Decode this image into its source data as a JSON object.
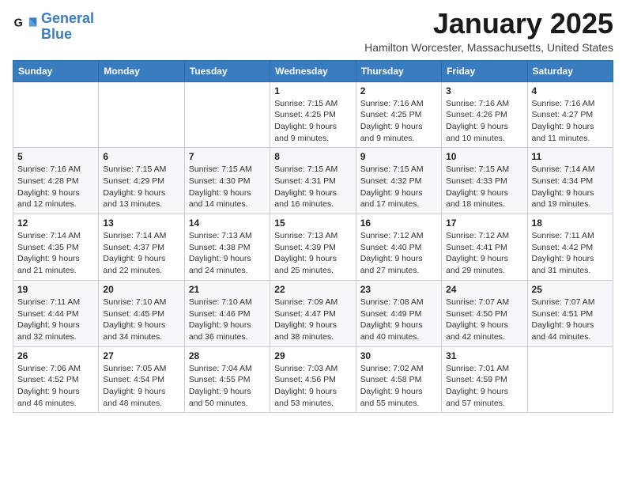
{
  "logo": {
    "line1": "General",
    "line2": "Blue"
  },
  "title": "January 2025",
  "location": "Hamilton Worcester, Massachusetts, United States",
  "weekdays": [
    "Sunday",
    "Monday",
    "Tuesday",
    "Wednesday",
    "Thursday",
    "Friday",
    "Saturday"
  ],
  "weeks": [
    [
      {
        "day": "",
        "info": ""
      },
      {
        "day": "",
        "info": ""
      },
      {
        "day": "",
        "info": ""
      },
      {
        "day": "1",
        "info": "Sunrise: 7:15 AM\nSunset: 4:25 PM\nDaylight: 9 hours\nand 9 minutes."
      },
      {
        "day": "2",
        "info": "Sunrise: 7:16 AM\nSunset: 4:25 PM\nDaylight: 9 hours\nand 9 minutes."
      },
      {
        "day": "3",
        "info": "Sunrise: 7:16 AM\nSunset: 4:26 PM\nDaylight: 9 hours\nand 10 minutes."
      },
      {
        "day": "4",
        "info": "Sunrise: 7:16 AM\nSunset: 4:27 PM\nDaylight: 9 hours\nand 11 minutes."
      }
    ],
    [
      {
        "day": "5",
        "info": "Sunrise: 7:16 AM\nSunset: 4:28 PM\nDaylight: 9 hours\nand 12 minutes."
      },
      {
        "day": "6",
        "info": "Sunrise: 7:15 AM\nSunset: 4:29 PM\nDaylight: 9 hours\nand 13 minutes."
      },
      {
        "day": "7",
        "info": "Sunrise: 7:15 AM\nSunset: 4:30 PM\nDaylight: 9 hours\nand 14 minutes."
      },
      {
        "day": "8",
        "info": "Sunrise: 7:15 AM\nSunset: 4:31 PM\nDaylight: 9 hours\nand 16 minutes."
      },
      {
        "day": "9",
        "info": "Sunrise: 7:15 AM\nSunset: 4:32 PM\nDaylight: 9 hours\nand 17 minutes."
      },
      {
        "day": "10",
        "info": "Sunrise: 7:15 AM\nSunset: 4:33 PM\nDaylight: 9 hours\nand 18 minutes."
      },
      {
        "day": "11",
        "info": "Sunrise: 7:14 AM\nSunset: 4:34 PM\nDaylight: 9 hours\nand 19 minutes."
      }
    ],
    [
      {
        "day": "12",
        "info": "Sunrise: 7:14 AM\nSunset: 4:35 PM\nDaylight: 9 hours\nand 21 minutes."
      },
      {
        "day": "13",
        "info": "Sunrise: 7:14 AM\nSunset: 4:37 PM\nDaylight: 9 hours\nand 22 minutes."
      },
      {
        "day": "14",
        "info": "Sunrise: 7:13 AM\nSunset: 4:38 PM\nDaylight: 9 hours\nand 24 minutes."
      },
      {
        "day": "15",
        "info": "Sunrise: 7:13 AM\nSunset: 4:39 PM\nDaylight: 9 hours\nand 25 minutes."
      },
      {
        "day": "16",
        "info": "Sunrise: 7:12 AM\nSunset: 4:40 PM\nDaylight: 9 hours\nand 27 minutes."
      },
      {
        "day": "17",
        "info": "Sunrise: 7:12 AM\nSunset: 4:41 PM\nDaylight: 9 hours\nand 29 minutes."
      },
      {
        "day": "18",
        "info": "Sunrise: 7:11 AM\nSunset: 4:42 PM\nDaylight: 9 hours\nand 31 minutes."
      }
    ],
    [
      {
        "day": "19",
        "info": "Sunrise: 7:11 AM\nSunset: 4:44 PM\nDaylight: 9 hours\nand 32 minutes."
      },
      {
        "day": "20",
        "info": "Sunrise: 7:10 AM\nSunset: 4:45 PM\nDaylight: 9 hours\nand 34 minutes."
      },
      {
        "day": "21",
        "info": "Sunrise: 7:10 AM\nSunset: 4:46 PM\nDaylight: 9 hours\nand 36 minutes."
      },
      {
        "day": "22",
        "info": "Sunrise: 7:09 AM\nSunset: 4:47 PM\nDaylight: 9 hours\nand 38 minutes."
      },
      {
        "day": "23",
        "info": "Sunrise: 7:08 AM\nSunset: 4:49 PM\nDaylight: 9 hours\nand 40 minutes."
      },
      {
        "day": "24",
        "info": "Sunrise: 7:07 AM\nSunset: 4:50 PM\nDaylight: 9 hours\nand 42 minutes."
      },
      {
        "day": "25",
        "info": "Sunrise: 7:07 AM\nSunset: 4:51 PM\nDaylight: 9 hours\nand 44 minutes."
      }
    ],
    [
      {
        "day": "26",
        "info": "Sunrise: 7:06 AM\nSunset: 4:52 PM\nDaylight: 9 hours\nand 46 minutes."
      },
      {
        "day": "27",
        "info": "Sunrise: 7:05 AM\nSunset: 4:54 PM\nDaylight: 9 hours\nand 48 minutes."
      },
      {
        "day": "28",
        "info": "Sunrise: 7:04 AM\nSunset: 4:55 PM\nDaylight: 9 hours\nand 50 minutes."
      },
      {
        "day": "29",
        "info": "Sunrise: 7:03 AM\nSunset: 4:56 PM\nDaylight: 9 hours\nand 53 minutes."
      },
      {
        "day": "30",
        "info": "Sunrise: 7:02 AM\nSunset: 4:58 PM\nDaylight: 9 hours\nand 55 minutes."
      },
      {
        "day": "31",
        "info": "Sunrise: 7:01 AM\nSunset: 4:59 PM\nDaylight: 9 hours\nand 57 minutes."
      },
      {
        "day": "",
        "info": ""
      }
    ]
  ]
}
